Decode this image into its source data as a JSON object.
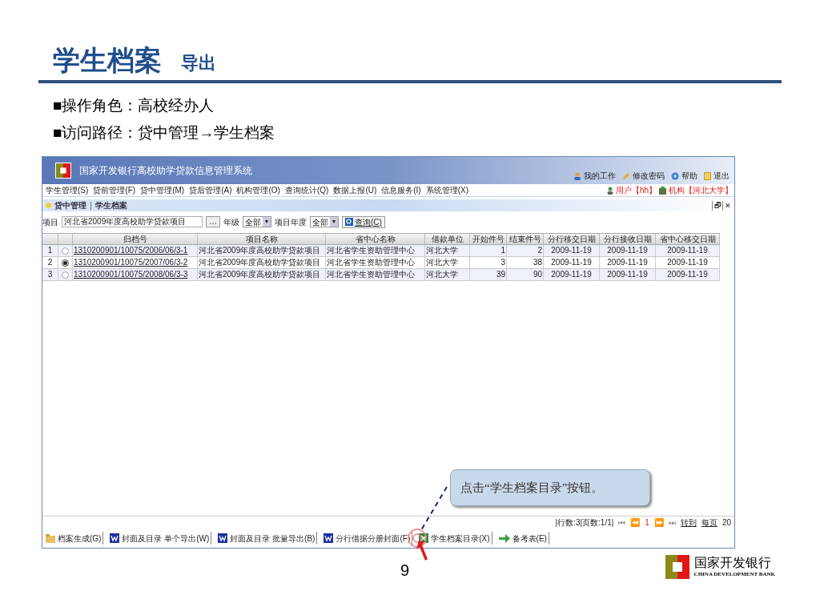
{
  "slide": {
    "title": "学生档案",
    "subtitle": "导出",
    "bullets": [
      {
        "mark": "■",
        "text": "操作角色：高校经办人"
      },
      {
        "mark": "■",
        "text": "访问路径：贷中管理→学生档案"
      }
    ],
    "page_number": "9"
  },
  "app": {
    "title": "国家开发银行高校助学贷款信息管理系统",
    "top_links": [
      {
        "kind": "user",
        "label": "我的工作"
      },
      {
        "kind": "pencil",
        "label": "修改密码"
      },
      {
        "kind": "help",
        "label": "帮助"
      },
      {
        "kind": "exit",
        "label": "退出"
      }
    ],
    "menu": [
      "学生管理(S)",
      "贷前管理(F)",
      "贷中管理(M)",
      "贷后管理(A)",
      "机构管理(O)",
      "查询统计(Q)",
      "数据上报(U)",
      "信息服务(I)",
      "系统管理(X)"
    ],
    "user": "用户【hh】",
    "org": "机构【河北大学】",
    "breadcrumb": [
      "贷中管理",
      "学生档案"
    ],
    "breadcrumb_separator": "|",
    "window_buttons": [
      "🗗",
      "✕"
    ],
    "filter": {
      "project_label": "项目",
      "project_value": "河北省2009年度高校助学贷款项目",
      "browse": "…",
      "grade_label": "年级",
      "grade_value": "全部",
      "grade_arrow": "▼",
      "year_label": "项目年度",
      "year_value": "全部",
      "year_arrow": "▼",
      "query": "查询(C)"
    },
    "table": {
      "columns": [
        "归档号",
        "项目名称",
        "省中心名称",
        "借款单位",
        "开始件号",
        "结束件号",
        "分行移交日期",
        "分行接收日期",
        "省中心移交日期"
      ],
      "rows": [
        {
          "index": "1",
          "selected": false,
          "cells": [
            "1310200901/10075/2006/06/3-1",
            "河北省2009年度高校助学贷款项目",
            "河北省学生资助管理中心",
            "河北大学",
            "1",
            "2",
            "2009-11-19",
            "2009-11-19",
            "2009-11-19"
          ]
        },
        {
          "index": "2",
          "selected": true,
          "cells": [
            "1310200901/10075/2007/06/3-2",
            "河北省2009年度高校助学贷款项目",
            "河北省学生资助管理中心",
            "河北大学",
            "3",
            "38",
            "2009-11-19",
            "2009-11-19",
            "2009-11-19"
          ]
        },
        {
          "index": "3",
          "selected": false,
          "cells": [
            "1310200901/10075/2008/06/3-3",
            "河北省2009年度高校助学贷款项目",
            "河北省学生资助管理中心",
            "河北大学",
            "39",
            "90",
            "2009-11-19",
            "2009-11-19",
            "2009-11-19"
          ]
        }
      ]
    },
    "pagination": {
      "summary": "|行数:3|页数:1/1|",
      "first": "⏮",
      "prev": "⏪",
      "page": "1",
      "next": "⏩",
      "last": "⏭",
      "goto": "转到",
      "per_page_label": "每页",
      "per_page": "20"
    },
    "toolbar": [
      {
        "kind": "folder",
        "label": "档案生成(G)"
      },
      {
        "kind": "word",
        "label": "封面及目录 单个导出(W)"
      },
      {
        "kind": "word",
        "label": "封面及目录 批量导出(B)"
      },
      {
        "kind": "word",
        "label": "分行借据分册封面(F)"
      },
      {
        "kind": "excel",
        "label": "学生档案目录(X)"
      },
      {
        "kind": "arrow",
        "label": "备考表(E)"
      }
    ]
  },
  "callout": "点击“学生档案目录”按钮。",
  "logo": {
    "name": "国家开发银行",
    "english": "CHINA DEVELOPMENT BANK"
  }
}
